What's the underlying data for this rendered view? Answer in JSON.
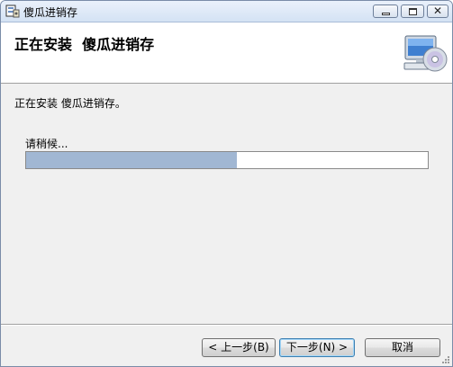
{
  "window": {
    "title": "傻瓜进销存",
    "close_glyph": "✕"
  },
  "banner": {
    "title": "正在安装  傻瓜进销存",
    "icon": "computer-cd-icon"
  },
  "content": {
    "status_message": "正在安装 傻瓜进销存。",
    "wait_label": "请稍候...",
    "progress_fraction": 0.525
  },
  "buttons": {
    "back": "< 上一步(B)",
    "next": "下一步(N) >",
    "cancel": "取消"
  },
  "colors": {
    "progress_fill": "#a1b7d3",
    "titlebar": "#dce7f5"
  }
}
